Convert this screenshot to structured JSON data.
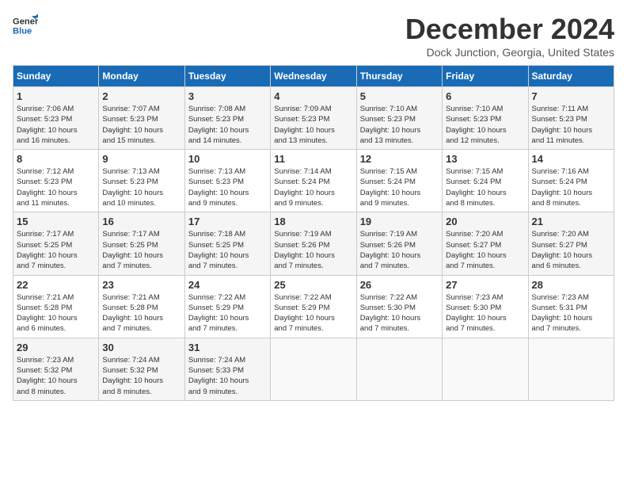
{
  "logo": {
    "line1": "General",
    "line2": "Blue"
  },
  "title": "December 2024",
  "subtitle": "Dock Junction, Georgia, United States",
  "days_of_week": [
    "Sunday",
    "Monday",
    "Tuesday",
    "Wednesday",
    "Thursday",
    "Friday",
    "Saturday"
  ],
  "weeks": [
    [
      {
        "day": "1",
        "info": "Sunrise: 7:06 AM\nSunset: 5:23 PM\nDaylight: 10 hours\nand 16 minutes."
      },
      {
        "day": "2",
        "info": "Sunrise: 7:07 AM\nSunset: 5:23 PM\nDaylight: 10 hours\nand 15 minutes."
      },
      {
        "day": "3",
        "info": "Sunrise: 7:08 AM\nSunset: 5:23 PM\nDaylight: 10 hours\nand 14 minutes."
      },
      {
        "day": "4",
        "info": "Sunrise: 7:09 AM\nSunset: 5:23 PM\nDaylight: 10 hours\nand 13 minutes."
      },
      {
        "day": "5",
        "info": "Sunrise: 7:10 AM\nSunset: 5:23 PM\nDaylight: 10 hours\nand 13 minutes."
      },
      {
        "day": "6",
        "info": "Sunrise: 7:10 AM\nSunset: 5:23 PM\nDaylight: 10 hours\nand 12 minutes."
      },
      {
        "day": "7",
        "info": "Sunrise: 7:11 AM\nSunset: 5:23 PM\nDaylight: 10 hours\nand 11 minutes."
      }
    ],
    [
      {
        "day": "8",
        "info": "Sunrise: 7:12 AM\nSunset: 5:23 PM\nDaylight: 10 hours\nand 11 minutes."
      },
      {
        "day": "9",
        "info": "Sunrise: 7:13 AM\nSunset: 5:23 PM\nDaylight: 10 hours\nand 10 minutes."
      },
      {
        "day": "10",
        "info": "Sunrise: 7:13 AM\nSunset: 5:23 PM\nDaylight: 10 hours\nand 9 minutes."
      },
      {
        "day": "11",
        "info": "Sunrise: 7:14 AM\nSunset: 5:24 PM\nDaylight: 10 hours\nand 9 minutes."
      },
      {
        "day": "12",
        "info": "Sunrise: 7:15 AM\nSunset: 5:24 PM\nDaylight: 10 hours\nand 9 minutes."
      },
      {
        "day": "13",
        "info": "Sunrise: 7:15 AM\nSunset: 5:24 PM\nDaylight: 10 hours\nand 8 minutes."
      },
      {
        "day": "14",
        "info": "Sunrise: 7:16 AM\nSunset: 5:24 PM\nDaylight: 10 hours\nand 8 minutes."
      }
    ],
    [
      {
        "day": "15",
        "info": "Sunrise: 7:17 AM\nSunset: 5:25 PM\nDaylight: 10 hours\nand 7 minutes."
      },
      {
        "day": "16",
        "info": "Sunrise: 7:17 AM\nSunset: 5:25 PM\nDaylight: 10 hours\nand 7 minutes."
      },
      {
        "day": "17",
        "info": "Sunrise: 7:18 AM\nSunset: 5:25 PM\nDaylight: 10 hours\nand 7 minutes."
      },
      {
        "day": "18",
        "info": "Sunrise: 7:19 AM\nSunset: 5:26 PM\nDaylight: 10 hours\nand 7 minutes."
      },
      {
        "day": "19",
        "info": "Sunrise: 7:19 AM\nSunset: 5:26 PM\nDaylight: 10 hours\nand 7 minutes."
      },
      {
        "day": "20",
        "info": "Sunrise: 7:20 AM\nSunset: 5:27 PM\nDaylight: 10 hours\nand 7 minutes."
      },
      {
        "day": "21",
        "info": "Sunrise: 7:20 AM\nSunset: 5:27 PM\nDaylight: 10 hours\nand 6 minutes."
      }
    ],
    [
      {
        "day": "22",
        "info": "Sunrise: 7:21 AM\nSunset: 5:28 PM\nDaylight: 10 hours\nand 6 minutes."
      },
      {
        "day": "23",
        "info": "Sunrise: 7:21 AM\nSunset: 5:28 PM\nDaylight: 10 hours\nand 7 minutes."
      },
      {
        "day": "24",
        "info": "Sunrise: 7:22 AM\nSunset: 5:29 PM\nDaylight: 10 hours\nand 7 minutes."
      },
      {
        "day": "25",
        "info": "Sunrise: 7:22 AM\nSunset: 5:29 PM\nDaylight: 10 hours\nand 7 minutes."
      },
      {
        "day": "26",
        "info": "Sunrise: 7:22 AM\nSunset: 5:30 PM\nDaylight: 10 hours\nand 7 minutes."
      },
      {
        "day": "27",
        "info": "Sunrise: 7:23 AM\nSunset: 5:30 PM\nDaylight: 10 hours\nand 7 minutes."
      },
      {
        "day": "28",
        "info": "Sunrise: 7:23 AM\nSunset: 5:31 PM\nDaylight: 10 hours\nand 7 minutes."
      }
    ],
    [
      {
        "day": "29",
        "info": "Sunrise: 7:23 AM\nSunset: 5:32 PM\nDaylight: 10 hours\nand 8 minutes."
      },
      {
        "day": "30",
        "info": "Sunrise: 7:24 AM\nSunset: 5:32 PM\nDaylight: 10 hours\nand 8 minutes."
      },
      {
        "day": "31",
        "info": "Sunrise: 7:24 AM\nSunset: 5:33 PM\nDaylight: 10 hours\nand 9 minutes."
      },
      {
        "day": "",
        "info": ""
      },
      {
        "day": "",
        "info": ""
      },
      {
        "day": "",
        "info": ""
      },
      {
        "day": "",
        "info": ""
      }
    ]
  ]
}
